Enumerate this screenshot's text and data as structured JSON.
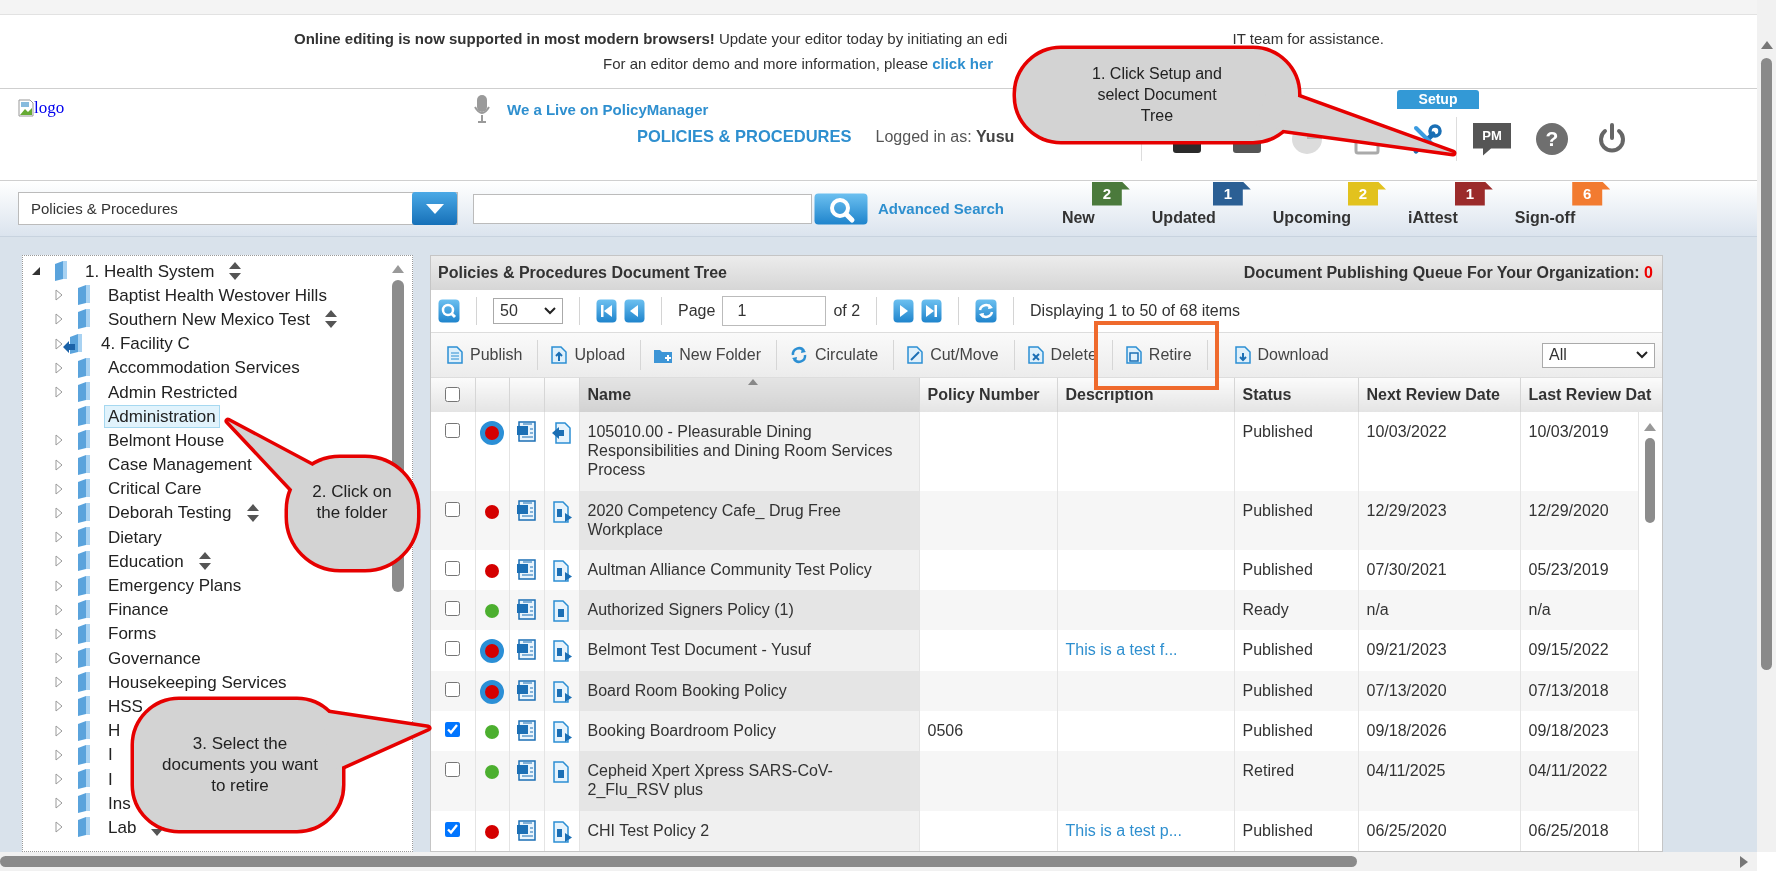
{
  "banner": {
    "notice_heading": "Online editing is now supported in most modern browsers!",
    "notice_text": "Update your editor today by initiating an edi",
    "notice_text_end": "IT team for assistance.",
    "demo_text": "For an editor demo and more information, please",
    "demo_link": "click her"
  },
  "header": {
    "logo_alt": "logo",
    "live_link": "We a Live on PolicyManager",
    "section_title": "POLICIES & PROCEDURES",
    "logged_in": "Logged in as: **Yusu**",
    "setup_label": "Setup",
    "pm_label": "PM",
    "help_symbol": "?"
  },
  "search_bar": {
    "scope": "Policies & Procedures",
    "advanced_link": "Advanced Search"
  },
  "counters": [
    {
      "label": "New",
      "count": "2",
      "color": "#4b7a3c"
    },
    {
      "label": "Updated",
      "count": "1",
      "color": "#2b5f94"
    },
    {
      "label": "Upcoming",
      "count": "2",
      "color": "#e2c21e"
    },
    {
      "label": "iAttest",
      "count": "1",
      "color": "#9b2b2b"
    },
    {
      "label": "Sign-off",
      "count": "6",
      "color": "#f27b30"
    }
  ],
  "tree": {
    "root": {
      "label": "1. Health System",
      "expanded": true,
      "sortable": true,
      "children": [
        {
          "label": "Baptist Health Westover Hills",
          "kind": "folder",
          "expandable": true,
          "sortable": false,
          "selected": false
        },
        {
          "label": "Southern New Mexico Test",
          "kind": "folder",
          "expandable": true,
          "sortable": true,
          "selected": false
        },
        {
          "label": "4. Facility C",
          "kind": "linked",
          "expandable": true,
          "sortable": false,
          "selected": false
        },
        {
          "label": "Accommodation Services",
          "kind": "folder",
          "expandable": true,
          "sortable": false,
          "selected": false
        },
        {
          "label": "Admin Restricted",
          "kind": "folder",
          "expandable": true,
          "sortable": false,
          "selected": false
        },
        {
          "label": "Administration",
          "kind": "folder",
          "expandable": false,
          "sortable": false,
          "selected": true
        },
        {
          "label": "Belmont House",
          "kind": "folder",
          "expandable": true,
          "sortable": false,
          "selected": false
        },
        {
          "label": "Case Management",
          "kind": "folder",
          "expandable": true,
          "sortable": false,
          "selected": false
        },
        {
          "label": "Critical Care",
          "kind": "folder",
          "expandable": true,
          "sortable": false,
          "selected": false
        },
        {
          "label": "Deborah Testing",
          "kind": "folder",
          "expandable": true,
          "sortable": true,
          "selected": false
        },
        {
          "label": "Dietary",
          "kind": "folder",
          "expandable": true,
          "sortable": false,
          "selected": false
        },
        {
          "label": "Education",
          "kind": "folder",
          "expandable": true,
          "sortable": true,
          "selected": false
        },
        {
          "label": "Emergency Plans",
          "kind": "folder",
          "expandable": true,
          "sortable": false,
          "selected": false
        },
        {
          "label": "Finance",
          "kind": "folder",
          "expandable": true,
          "sortable": false,
          "selected": false
        },
        {
          "label": "Forms",
          "kind": "folder",
          "expandable": true,
          "sortable": false,
          "selected": false
        },
        {
          "label": "Governance",
          "kind": "folder",
          "expandable": true,
          "sortable": false,
          "selected": false
        },
        {
          "label": "Housekeeping Services",
          "kind": "folder",
          "expandable": true,
          "sortable": false,
          "selected": false
        },
        {
          "label": "HSS",
          "kind": "folder",
          "expandable": true,
          "sortable": false,
          "selected": false
        },
        {
          "label": "H",
          "kind": "folder",
          "expandable": true,
          "sortable": false,
          "selected": false
        },
        {
          "label": "I",
          "kind": "folder",
          "expandable": true,
          "sortable": false,
          "selected": false
        },
        {
          "label": "I",
          "kind": "folder",
          "expandable": true,
          "sortable": false,
          "selected": false
        },
        {
          "label": "Ins",
          "kind": "folder",
          "expandable": true,
          "sortable": false,
          "selected": false
        },
        {
          "label": "Lab",
          "kind": "folder",
          "expandable": true,
          "sortable": true,
          "selected": false
        }
      ]
    }
  },
  "grid": {
    "title": "Policies & Procedures Document Tree",
    "queue_label": "Document Publishing Queue For Your Organization:",
    "queue_count": "0",
    "pager": {
      "page_size": "50",
      "page_label": "Page",
      "page": "1",
      "of_label": "of 2",
      "summary": "Displaying 1 to 50 of 68 items"
    },
    "actions": [
      {
        "label": "Publish",
        "kind": "publish"
      },
      {
        "label": "Upload",
        "kind": "upload"
      },
      {
        "label": "New Folder",
        "kind": "new-folder"
      },
      {
        "label": "Circulate",
        "kind": "circulate"
      },
      {
        "label": "Cut/Move",
        "kind": "cut-move"
      },
      {
        "label": "Delete",
        "kind": "delete"
      },
      {
        "label": "Retire",
        "kind": "retire"
      },
      {
        "label": "Download",
        "kind": "download"
      }
    ],
    "filter": "All",
    "select_all": {
      "checked": false
    },
    "columns": [
      "Name",
      "Policy Number",
      "Description",
      "Status",
      "Next Review Date",
      "Last Review Dat"
    ],
    "rows": [
      {
        "checked": false,
        "color": "#d40000",
        "ring": true,
        "kind": "arrow",
        "name": "105010.00 - Pleasurable Dining Responsibilities and Dining Room Services Process",
        "status": "Published",
        "next_review": "10/03/2022",
        "last_review": "10/03/2019"
      },
      {
        "checked": false,
        "color": "#d40000",
        "ring": false,
        "kind": "play",
        "name": "2020 Competency Cafe_ Drug Free Workplace",
        "status": "Published",
        "next_review": "12/29/2023",
        "last_review": "12/29/2020"
      },
      {
        "checked": false,
        "color": "#d40000",
        "ring": false,
        "kind": "play",
        "name": "Aultman Alliance Community Test Policy",
        "status": "Published",
        "next_review": "07/30/2021",
        "last_review": "05/23/2019"
      },
      {
        "checked": false,
        "color": "#4caf2f",
        "ring": false,
        "kind": "plain",
        "name": "Authorized Signers Policy (1)",
        "status": "Ready",
        "next_review": "n/a",
        "last_review": "n/a"
      },
      {
        "checked": false,
        "color": "#d40000",
        "ring": true,
        "kind": "play",
        "name": "Belmont Test Document - Yusuf",
        "description": "This is a test f...",
        "status": "Published",
        "next_review": "09/21/2023",
        "last_review": "09/15/2022"
      },
      {
        "checked": false,
        "color": "#d40000",
        "ring": true,
        "kind": "play",
        "name": "Board Room Booking Policy",
        "status": "Published",
        "next_review": "07/13/2020",
        "last_review": "07/13/2018"
      },
      {
        "checked": true,
        "color": "#4caf2f",
        "ring": false,
        "kind": "play",
        "name": "Booking Boardroom Policy",
        "policy_number": "0506",
        "status": "Published",
        "next_review": "09/18/2026",
        "last_review": "09/18/2023"
      },
      {
        "checked": false,
        "color": "#4caf2f",
        "ring": false,
        "kind": "plain",
        "name": "Cepheid Xpert Xpress SARS-CoV-2_Flu_RSV plus",
        "status": "Retired",
        "next_review": "04/11/2025",
        "last_review": "04/11/2022"
      },
      {
        "checked": true,
        "color": "#d40000",
        "ring": false,
        "kind": "play",
        "name": "CHI Test Policy 2",
        "description": "This is a test p...",
        "status": "Published",
        "next_review": "06/25/2020",
        "last_review": "06/25/2018"
      }
    ]
  },
  "callouts": [
    {
      "text": "1. Click Setup and select Document Tree"
    },
    {
      "text": "2. Click on the folder"
    },
    {
      "text": "3. Select the documents you want to retire"
    }
  ]
}
